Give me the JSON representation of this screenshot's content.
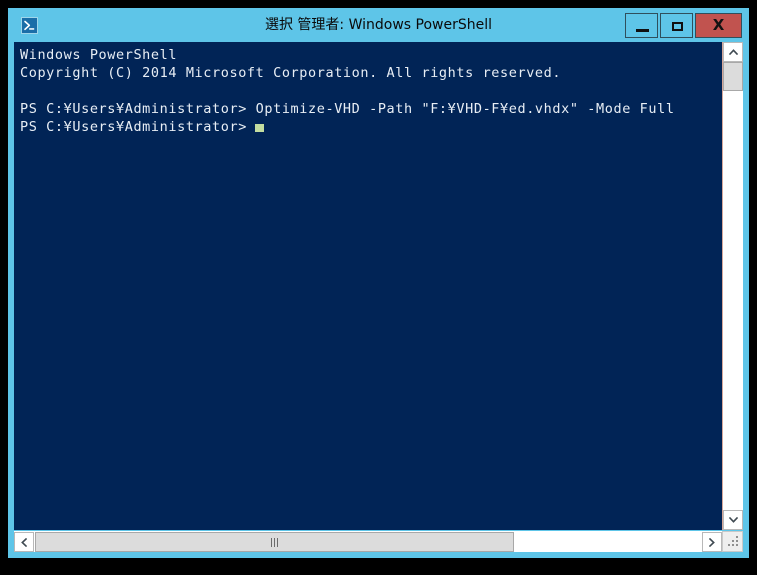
{
  "window": {
    "title": "選択 管理者: Windows PowerShell",
    "icon": "powershell-icon",
    "frame_color": "#5ec5e8",
    "desktop_color": "#000000",
    "controls": {
      "minimize_label": "−",
      "maximize_label": "□",
      "close_label": "X",
      "close_color": "#c1534f"
    }
  },
  "console": {
    "background_color": "#012456",
    "foreground_color": "#e8eef5",
    "cursor_color": "#c3dda0",
    "lines": [
      "Windows PowerShell",
      "Copyright (C) 2014 Microsoft Corporation. All rights reserved.",
      "",
      "PS C:¥Users¥Administrator> Optimize-VHD -Path \"F:¥VHD-F¥ed.vhdx\" -Mode Full"
    ],
    "prompt_line": "PS C:¥Users¥Administrator>",
    "banner": "Windows PowerShell",
    "copyright": "Copyright (C) 2014 Microsoft Corporation. All rights reserved.",
    "command": "PS C:¥Users¥Administrator> Optimize-VHD -Path \"F:¥VHD-F¥ed.vhdx\" -Mode Full"
  },
  "scrollbars": {
    "vertical": {
      "up_arrow": "▲",
      "down_arrow": "▼",
      "thumb_position_pct": 0
    },
    "horizontal": {
      "left_arrow": "◀",
      "right_arrow": "▶",
      "thumb_position_pct": 0
    }
  }
}
